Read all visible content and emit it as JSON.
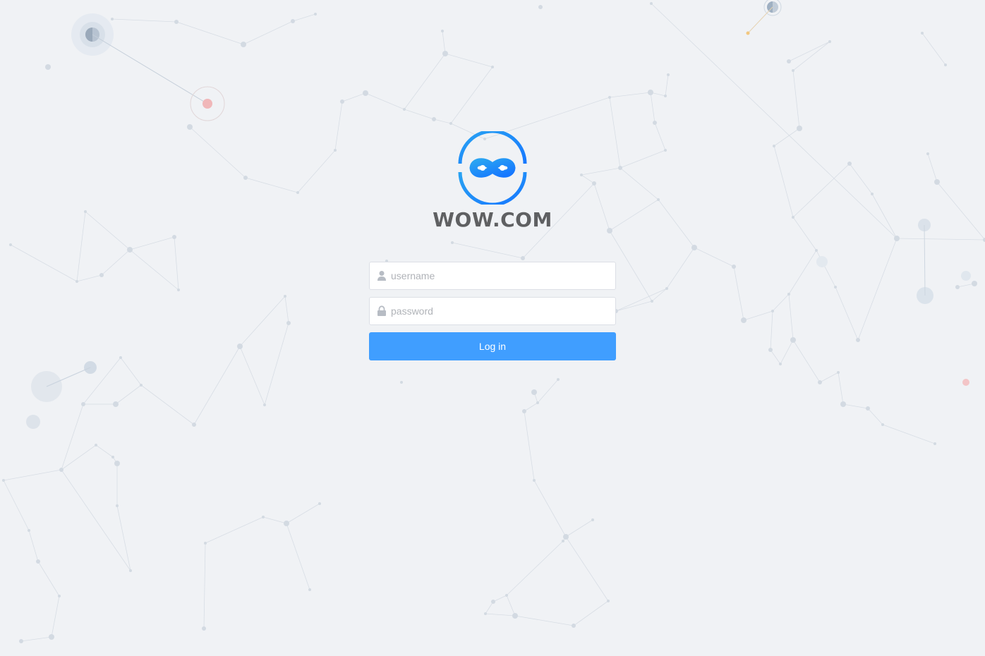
{
  "brand": {
    "name": "WOW.COM",
    "accent_color": "#409eff",
    "logo_icon": "infinity-ring-icon"
  },
  "login_form": {
    "username": {
      "placeholder": "username",
      "value": "",
      "icon": "user-icon"
    },
    "password": {
      "placeholder": "password",
      "value": "",
      "icon": "lock-icon"
    },
    "submit_label": "Log in"
  },
  "background": {
    "style": "network-constellation",
    "base_color": "#f0f2f5"
  }
}
